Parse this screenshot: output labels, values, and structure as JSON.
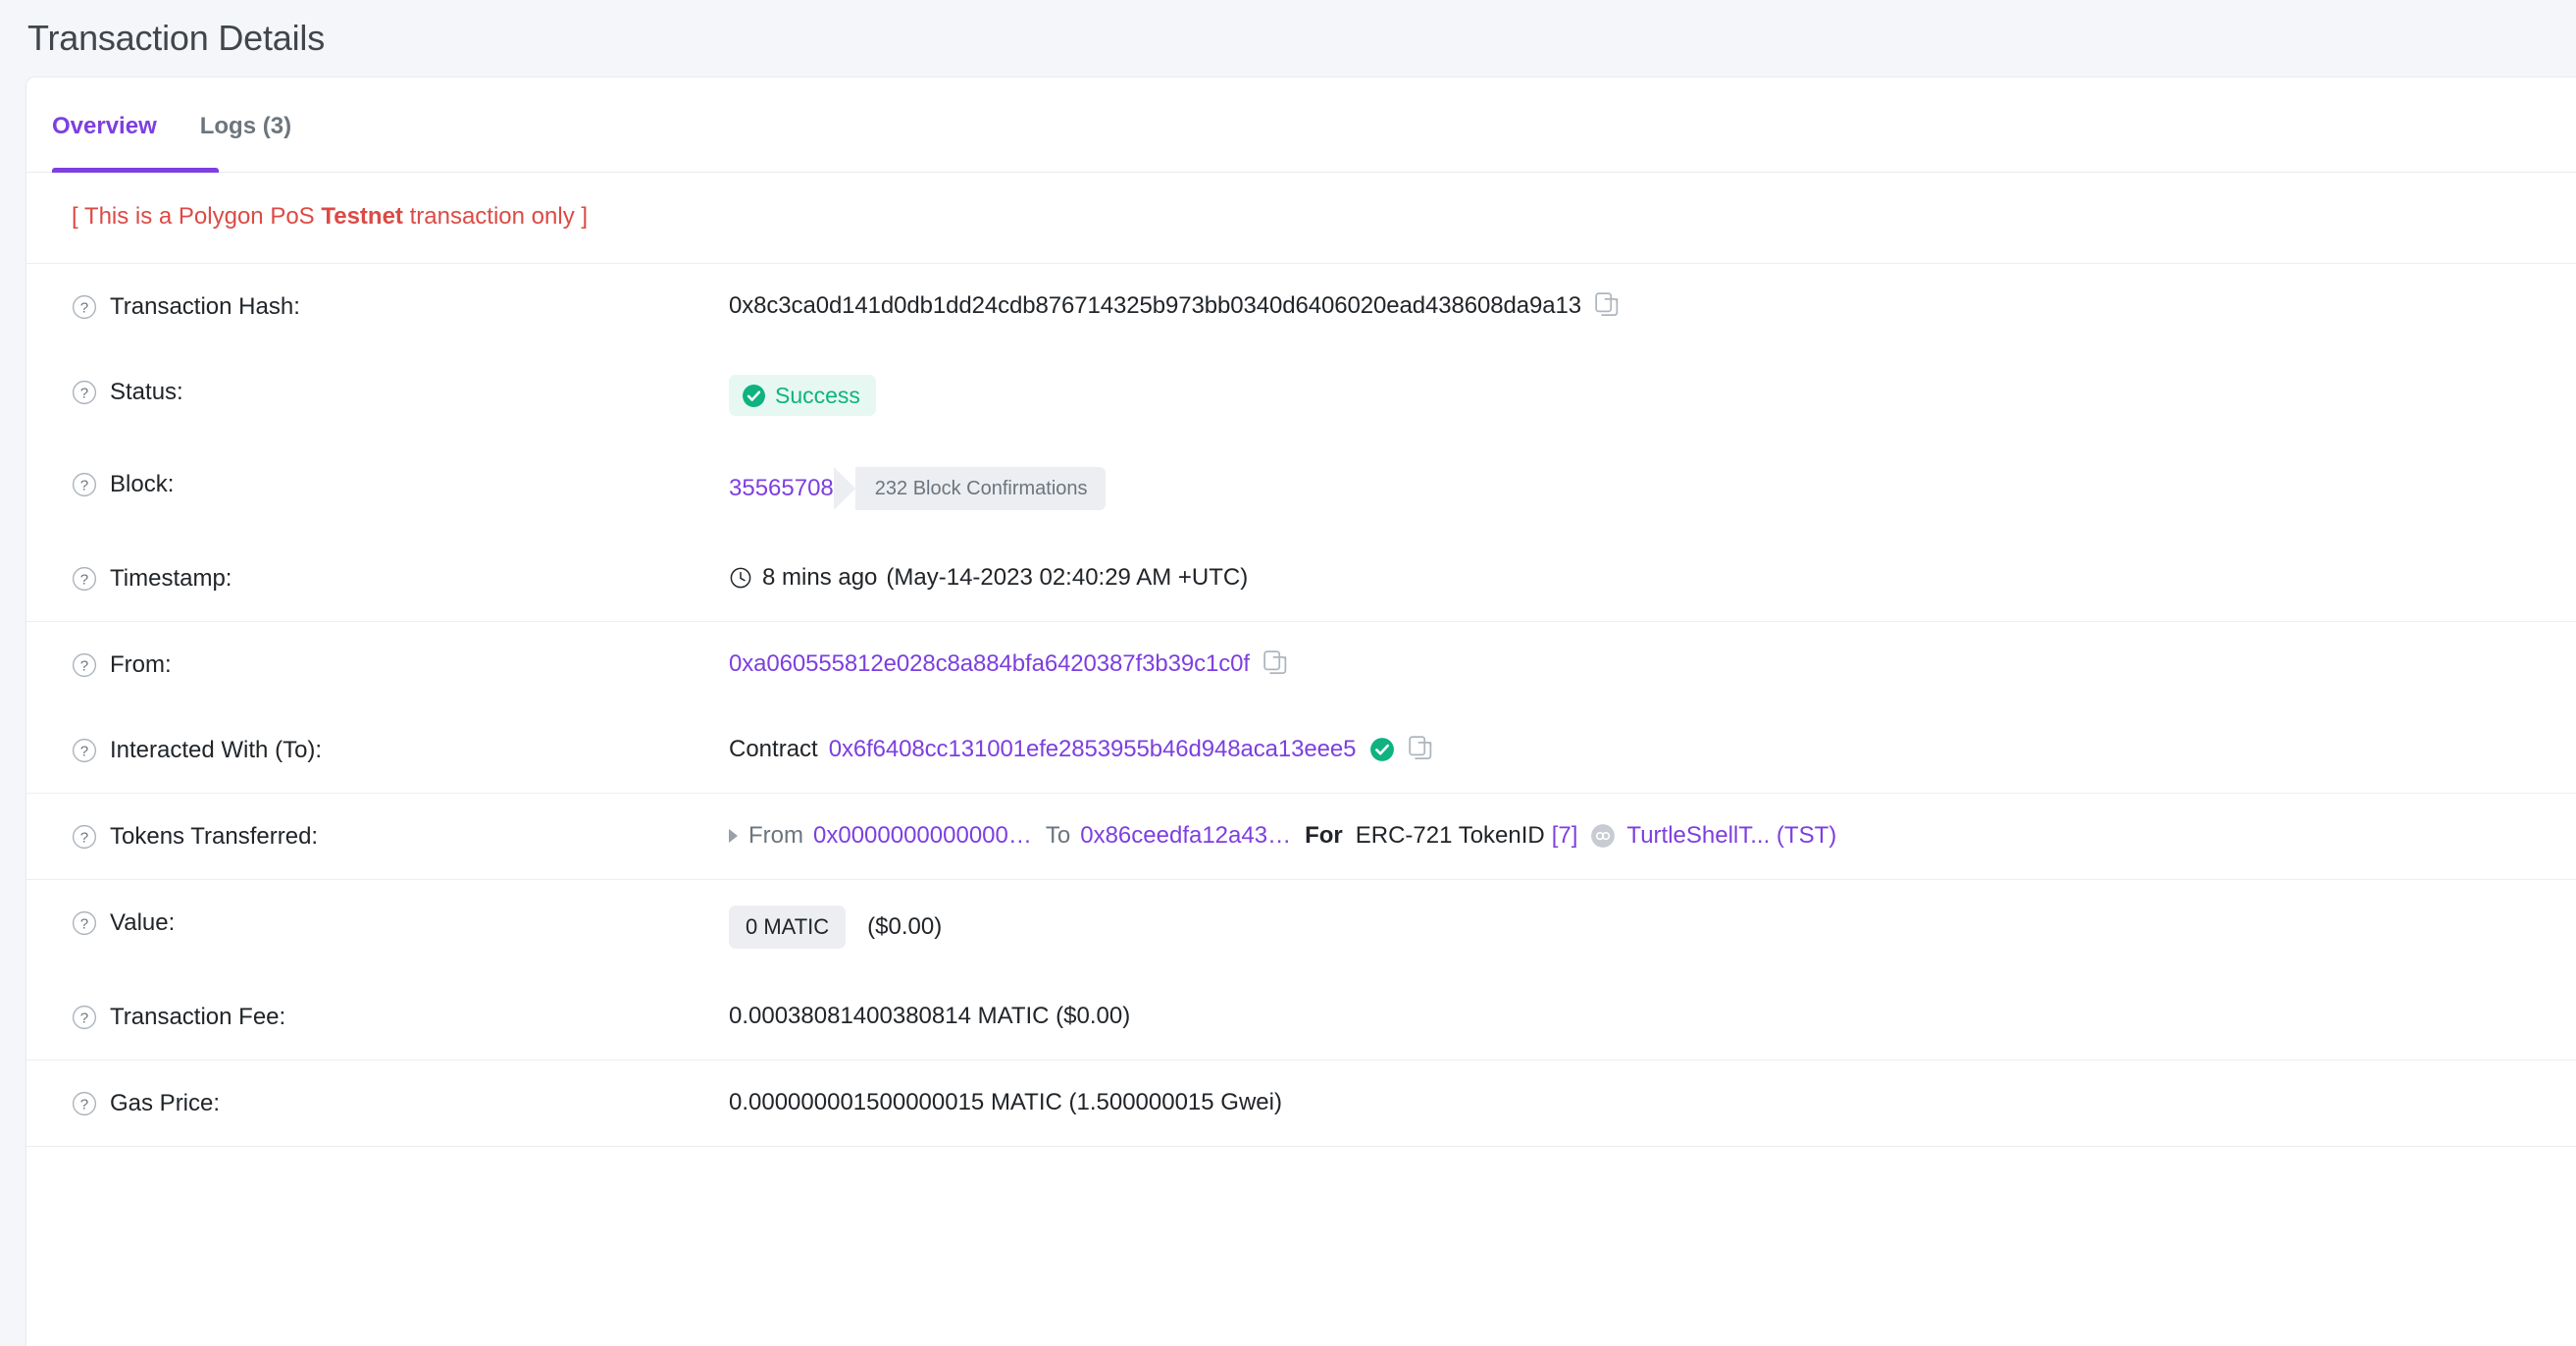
{
  "header": {
    "title": "Transaction Details"
  },
  "tabs": [
    {
      "label": "Overview",
      "active": true
    },
    {
      "label": "Logs (3)",
      "active": false
    }
  ],
  "banner": {
    "prefix": "[ This is a Polygon PoS ",
    "strong": "Testnet",
    "suffix": " transaction only ]",
    "color": "#dc4a45"
  },
  "rows": {
    "transaction_hash": {
      "label": "Transaction Hash:",
      "value": "0x8c3ca0d141d0db1dd24cdb876714325b973bb0340d6406020ead438608da9a13",
      "copy_icon": "copy-icon"
    },
    "status": {
      "label": "Status:",
      "badge_text": "Success",
      "badge_icon": "check-circle-icon",
      "badge_bg": "#e7f8f2",
      "badge_fg": "#0eb37f"
    },
    "block": {
      "label": "Block:",
      "number": "35565708",
      "confirmations": "232 Block Confirmations"
    },
    "timestamp": {
      "label": "Timestamp:",
      "icon": "clock-icon",
      "relative": "8 mins ago",
      "absolute": "(May-14-2023 02:40:29 AM +UTC)"
    },
    "from": {
      "label": "From:",
      "address": "0xa060555812e028c8a884bfa6420387f3b39c1c0f",
      "copy_icon": "copy-icon"
    },
    "interacted_with": {
      "label": "Interacted With (To):",
      "prefix": "Contract",
      "address": "0x6f6408cc131001efe2853955b46d948aca13eee5",
      "verified_icon": "verified-check-icon",
      "copy_icon": "copy-icon"
    },
    "tokens_transferred": {
      "label": "Tokens Transferred:",
      "expand_icon": "caret-right-icon",
      "from_word": "From",
      "from_address": "0x0000000000000…",
      "to_word": "To",
      "to_address": "0x86ceedfa12a43…",
      "for_word": "For",
      "standard": "ERC-721 TokenID",
      "token_id": "[7]",
      "token_icon": "token-placeholder-icon",
      "token_name": "TurtleShellT... (TST)"
    },
    "value": {
      "label": "Value:",
      "amount": "0 MATIC",
      "usd": "($0.00)"
    },
    "transaction_fee": {
      "label": "Transaction Fee:",
      "value": "0.00038081400380814 MATIC ($0.00)"
    },
    "gas_price": {
      "label": "Gas Price:",
      "value": "0.000000001500000015 MATIC (1.500000015 Gwei)"
    }
  },
  "theme": {
    "accent": "#7d3fe0",
    "success": "#0eb37f",
    "muted": "#6c757d",
    "page_bg": "#f5f6fa",
    "card_bg": "#ffffff",
    "divider": "#eceef1"
  }
}
